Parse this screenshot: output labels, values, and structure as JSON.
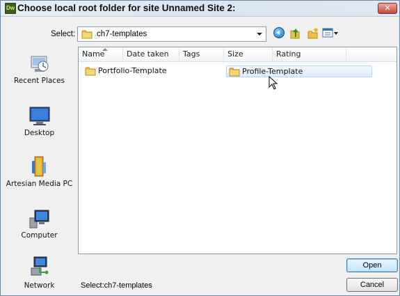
{
  "window": {
    "title": "Choose local root folder for site Unnamed Site 2:",
    "app_icon_text": "Dw"
  },
  "toolbar": {
    "select_label": "Select:",
    "current_folder": "ch7-templates",
    "icons": [
      "back-icon",
      "up-folder-icon",
      "new-folder-icon",
      "views-icon"
    ]
  },
  "places": [
    {
      "label": "Recent Places",
      "icon": "recent-places-icon"
    },
    {
      "label": "Desktop",
      "icon": "desktop-icon"
    },
    {
      "label": "Artesian Media PC",
      "icon": "user-folder-icon"
    },
    {
      "label": "Computer",
      "icon": "computer-icon"
    },
    {
      "label": "Network",
      "icon": "network-icon"
    }
  ],
  "columns": [
    "Name",
    "Date taken",
    "Tags",
    "Size",
    "Rating"
  ],
  "items": [
    {
      "label": "Portfolio-Template",
      "icon": "folder-icon"
    },
    {
      "label": "Profile-Template",
      "icon": "folder-icon"
    }
  ],
  "status": {
    "select_text": "Select:ch7-templates"
  },
  "buttons": {
    "open": "Open",
    "cancel": "Cancel"
  },
  "colors": {
    "folder": "#e8c04a",
    "accent": "#3c7fb1"
  }
}
